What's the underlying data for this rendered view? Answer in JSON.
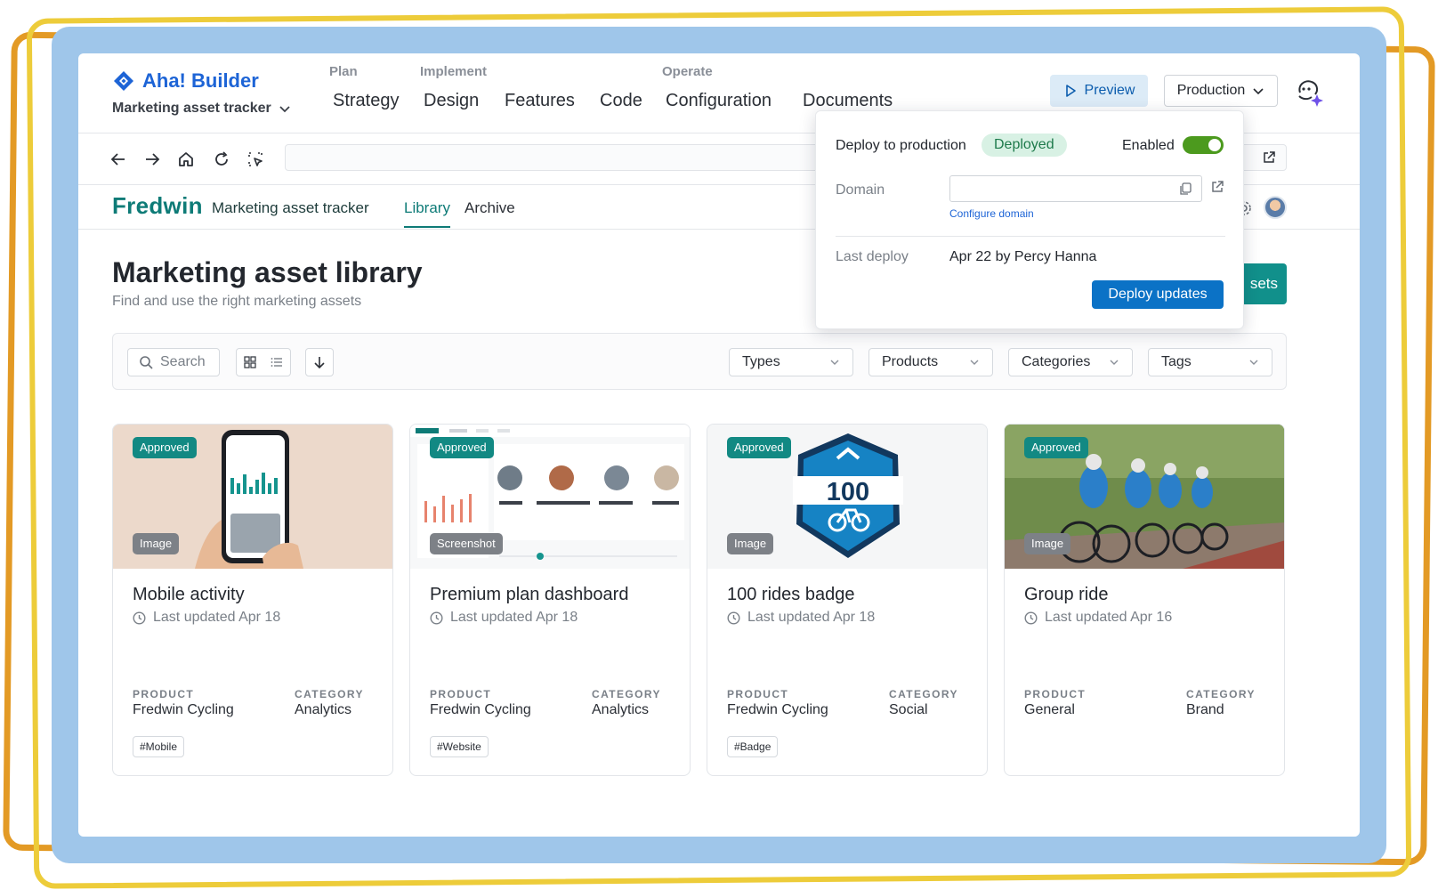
{
  "brand": {
    "name": "Aha! Builder",
    "product": "Marketing asset tracker",
    "color": "#1d64d6"
  },
  "nav": {
    "categories": [
      "Plan",
      "Implement",
      "Operate"
    ],
    "links": [
      "Strategy",
      "Design",
      "Features",
      "Code",
      "Configuration",
      "Documents"
    ]
  },
  "header_actions": {
    "preview": "Preview",
    "environment": "Production"
  },
  "app": {
    "logo": "Fredwin",
    "subtitle": "Marketing asset tracker",
    "tabs": [
      {
        "label": "Library",
        "active": true
      },
      {
        "label": "Archive",
        "active": false
      }
    ],
    "accent": "#0e7b77"
  },
  "page": {
    "title": "Marketing asset library",
    "subtitle": "Find and use the right marketing assets",
    "primary_action": "sets"
  },
  "filters": {
    "search_label": "Search",
    "dropdowns": [
      "Types",
      "Products",
      "Categories",
      "Tags"
    ]
  },
  "cards": [
    {
      "title": "Mobile activity",
      "status": "Approved",
      "kind": "Image",
      "updated": "Last updated Apr 18",
      "product_label": "PRODUCT",
      "product": "Fredwin Cycling",
      "category_label": "CATEGORY",
      "category": "Analytics",
      "tag": "#Mobile"
    },
    {
      "title": "Premium plan dashboard",
      "status": "Approved",
      "kind": "Screenshot",
      "updated": "Last updated Apr 18",
      "product_label": "PRODUCT",
      "product": "Fredwin Cycling",
      "category_label": "CATEGORY",
      "category": "Analytics",
      "tag": "#Website"
    },
    {
      "title": "100 rides badge",
      "status": "Approved",
      "kind": "Image",
      "updated": "Last updated Apr 18",
      "product_label": "PRODUCT",
      "product": "Fredwin Cycling",
      "category_label": "CATEGORY",
      "category": "Social",
      "tag": "#Badge",
      "badge_number": "100"
    },
    {
      "title": "Group ride",
      "status": "Approved",
      "kind": "Image",
      "updated": "Last updated Apr 16",
      "product_label": "PRODUCT",
      "product": "General",
      "category_label": "CATEGORY",
      "category": "Brand"
    }
  ],
  "deploy": {
    "title": "Deploy to production",
    "status": "Deployed",
    "enabled_label": "Enabled",
    "enabled": true,
    "domain_label": "Domain",
    "domain_value": "",
    "configure_link": "Configure domain",
    "last_deploy_label": "Last deploy",
    "last_deploy_value": "Apr 22 by Percy Hanna",
    "button": "Deploy updates"
  }
}
